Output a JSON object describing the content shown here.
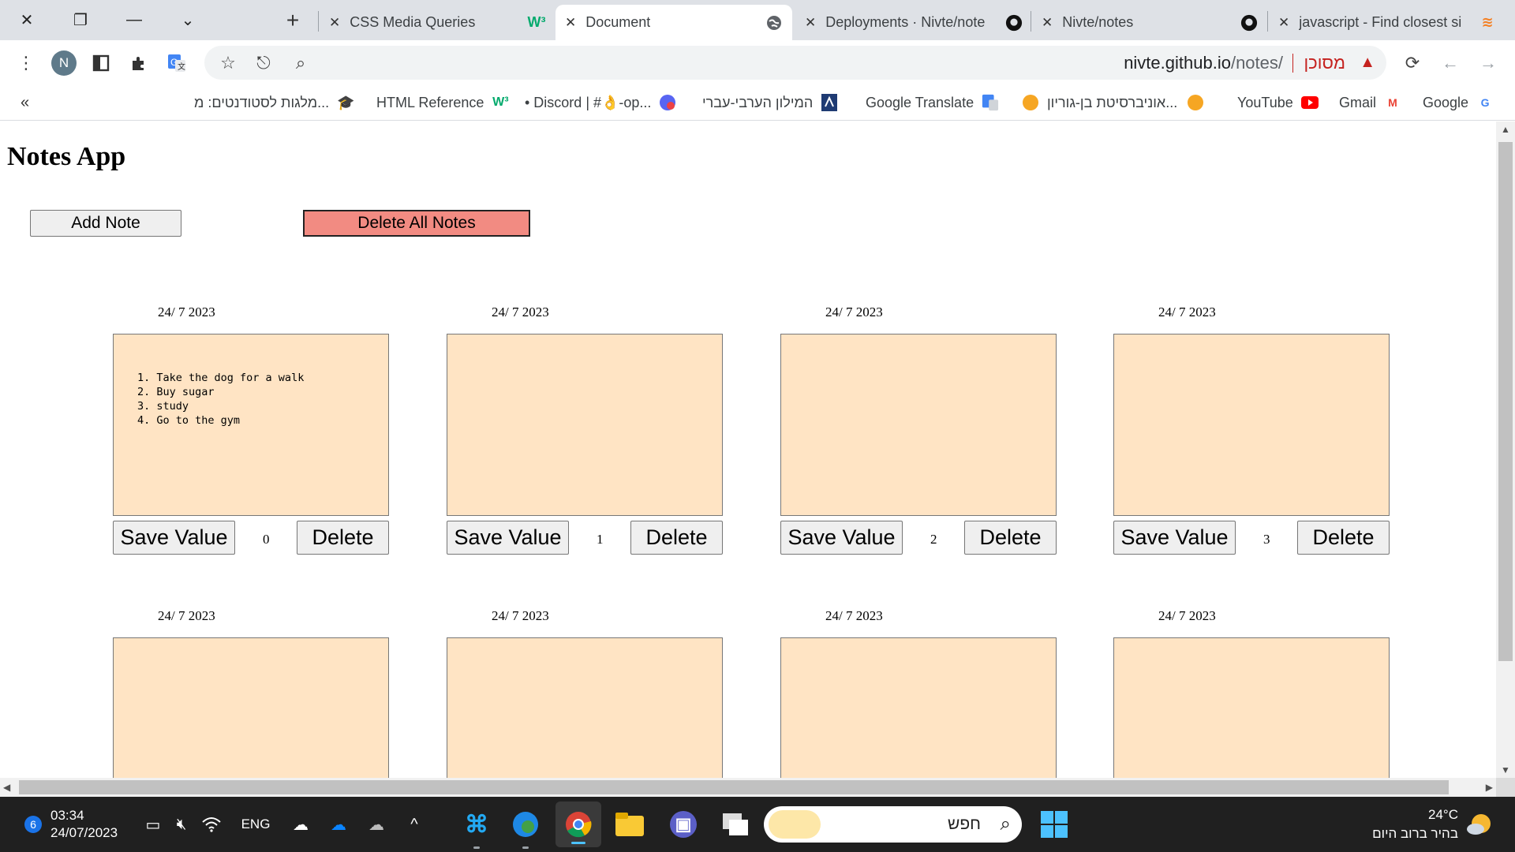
{
  "browser": {
    "tabs": [
      {
        "title": "CSS Media Queries",
        "favicon": "w3schools-icon"
      },
      {
        "title": "Document",
        "favicon": "globe-icon",
        "active": true
      },
      {
        "title": "Deployments · Nivte/note",
        "favicon": "github-icon"
      },
      {
        "title": "Nivte/notes",
        "favicon": "github-icon"
      },
      {
        "title": "javascript - Find closest si",
        "favicon": "stackoverflow-icon"
      }
    ],
    "address": {
      "host": "nivte.github.io",
      "path": "/notes/",
      "security_label": "מסוכן"
    },
    "profile_initial": "N",
    "bookmarks": [
      {
        "label": "Google",
        "icon": "google-icon"
      },
      {
        "label": "Gmail",
        "icon": "gmail-icon"
      },
      {
        "label": "YouTube",
        "icon": "youtube-icon"
      },
      {
        "label": "אוניברסיטת בן-גוריון...",
        "icon": "bgu-icon"
      },
      {
        "label": "Google Translate",
        "icon": "translate-icon"
      },
      {
        "label": "המילון הערבי-עברי",
        "icon": "dictionary-icon"
      },
      {
        "label": "• Discord | #👌-op...",
        "icon": "discord-icon"
      },
      {
        "label": "HTML Reference",
        "icon": "w3schools-icon"
      },
      {
        "label": "מלגות לסטודנטים: מ...",
        "icon": "scholarship-icon"
      }
    ]
  },
  "page": {
    "title": "Notes App",
    "add_note_label": "Add Note",
    "delete_all_label": "Delete All Notes",
    "notes": [
      {
        "date": "24/ 7 2023",
        "content": "1. Take the dog for a walk\n2. Buy sugar\n3. study\n4. Go to the gym",
        "index": "0",
        "save_label": "Save Value",
        "delete_label": "Delete"
      },
      {
        "date": "24/ 7 2023",
        "content": "",
        "index": "1",
        "save_label": "Save Value",
        "delete_label": "Delete"
      },
      {
        "date": "24/ 7 2023",
        "content": "",
        "index": "2",
        "save_label": "Save Value",
        "delete_label": "Delete"
      },
      {
        "date": "24/ 7 2023",
        "content": "",
        "index": "3",
        "save_label": "Save Value",
        "delete_label": "Delete"
      },
      {
        "date": "24/ 7 2023",
        "content": ""
      },
      {
        "date": "24/ 7 2023",
        "content": ""
      },
      {
        "date": "24/ 7 2023",
        "content": ""
      },
      {
        "date": "24/ 7 2023",
        "content": ""
      }
    ],
    "note_bg": "#ffe4c4",
    "delete_all_bg": "#f28b82"
  },
  "taskbar": {
    "notification_count": "6",
    "time": "03:34",
    "date": "24/07/2023",
    "language": "ENG",
    "search_placeholder": "חפש",
    "temperature": "24°C",
    "weather_text": "בהיר ברוב היום"
  }
}
